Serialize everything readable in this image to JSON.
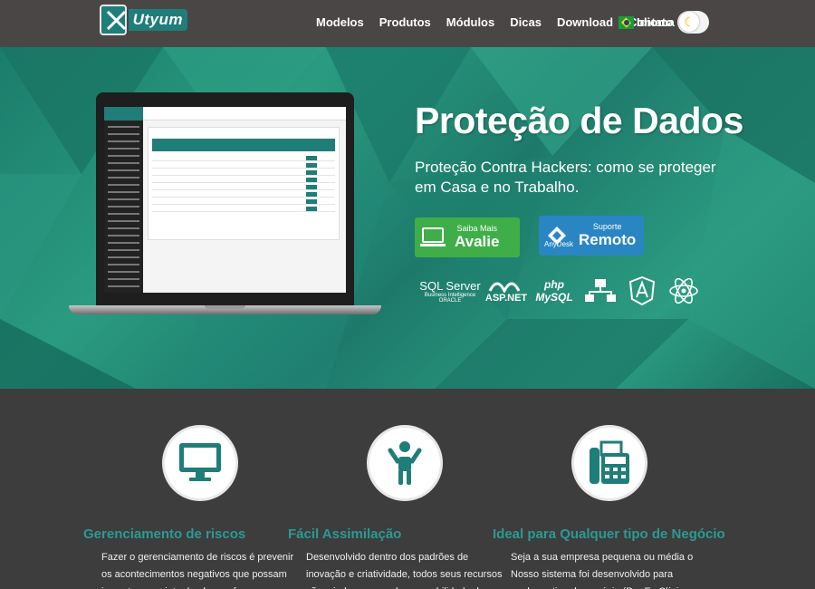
{
  "brand": {
    "logo_text": "Utyum"
  },
  "nav": {
    "items": [
      "Modelos",
      "Produtos",
      "Módulos",
      "Dicas",
      "Download",
      "Contato"
    ],
    "language_label": "Idioma",
    "theme_toggle_icon": "moon-icon"
  },
  "hero": {
    "title": "Proteção de Dados",
    "subtitle": "Proteção Contra Hackers: como se proteger em Casa e no Trabalho.",
    "button_evaluate": {
      "small": "Saiba Mais",
      "big": "Avalie"
    },
    "button_remote": {
      "small": "Suporte",
      "big": "Remoto",
      "brand": "AnyDesk"
    },
    "tech_logos": {
      "sql_server": "SQL Server",
      "sql_server_sub": "Business Intelligence",
      "oracle": "ORACLE",
      "asp": "ASP.NET",
      "php": "php",
      "mysql": "MySQL"
    }
  },
  "features": [
    {
      "icon": "monitor-icon",
      "title": "Gerenciamento de riscos",
      "text": "Fazer o gerenciamento de riscos é prevenir os acontecimentos negativos que possam impactar o projeto de alguma forma. Basicamente, esse"
    },
    {
      "icon": "person-icon",
      "title": "Fácil Assimilação",
      "text": "Desenvolvido dentro dos padrões de inovação e criatividade, todos seus recursos são criados pensando na usabilidade dos usuários"
    },
    {
      "icon": "fax-icon",
      "title": "Ideal para Qualquer tipo de Negócio",
      "text": "Seja a sua empresa pequena ou média o Nosso sistema foi desenvolvido para qualquer tipo de negócio (Por Ex Clínicas, Hospitais, Centros"
    }
  ],
  "colors": {
    "accent": "#2b9a93",
    "nav_bg": "#4a4646",
    "green_btn": "#3fae49",
    "blue_btn": "#2a86c3"
  }
}
